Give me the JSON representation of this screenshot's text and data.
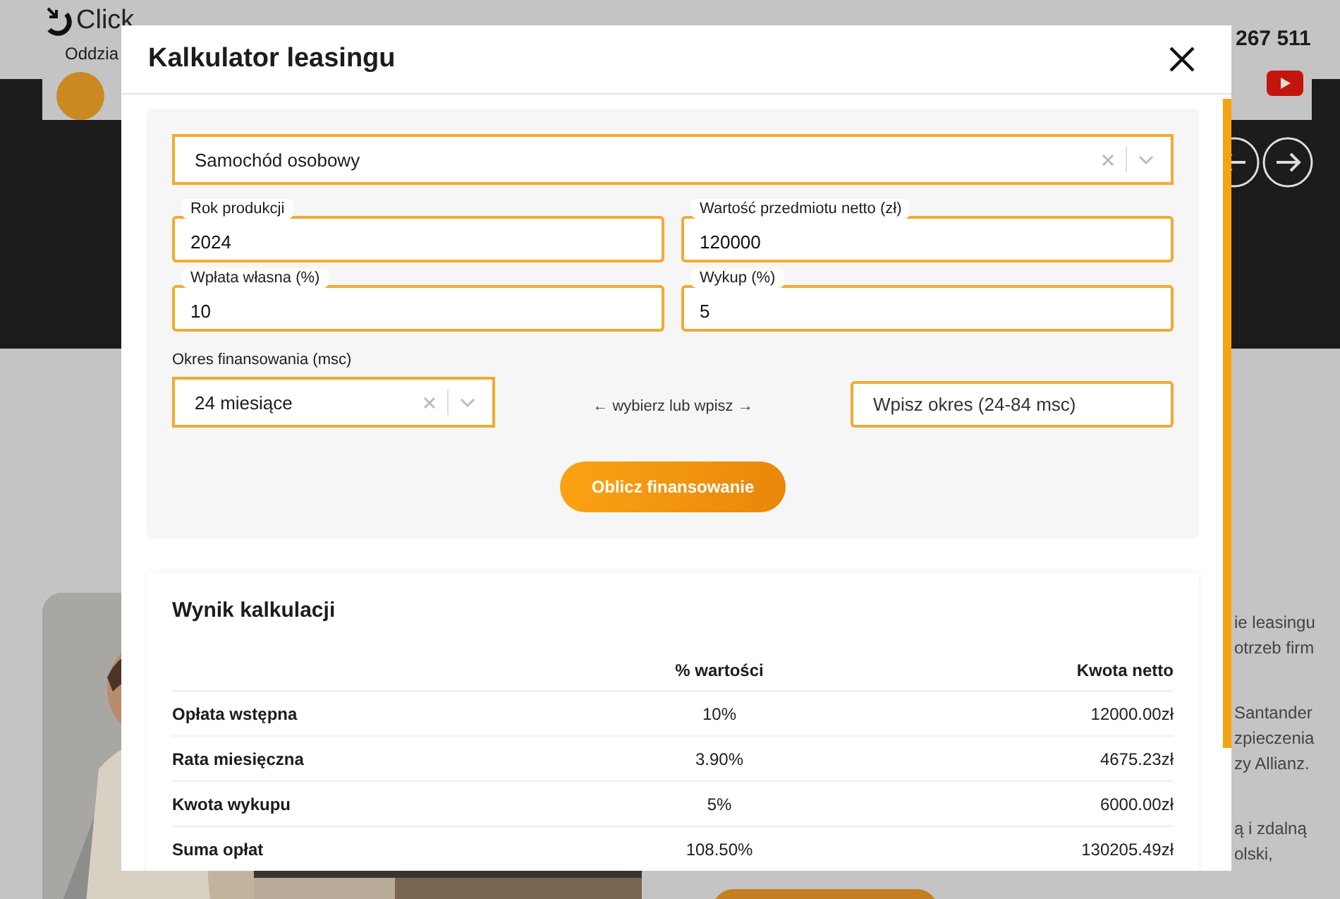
{
  "background_page": {
    "logo": "Click",
    "nav_item": "Oddzia",
    "phone": "267 511",
    "side_text": [
      "ie leasingu",
      "otrzeb firm",
      "Santander",
      "zpieczenia",
      "zy Allianz.",
      "ą i zdalną",
      "olski,"
    ]
  },
  "modal": {
    "title": "Kalkulator leasingu",
    "vehicle_select": {
      "value": "Samochód osobowy"
    },
    "fields": [
      {
        "label": "Rok produkcji",
        "value": "2024"
      },
      {
        "label": "Wartość przedmiotu netto (zł)",
        "value": "120000"
      },
      {
        "label": "Wpłata własna (%)",
        "value": "10"
      },
      {
        "label": "Wykup (%)",
        "value": "5"
      }
    ],
    "period": {
      "label": "Okres finansowania (msc)",
      "select_value": "24 miesiące",
      "hint": "← wybierz lub wpisz →",
      "input_placeholder": "Wpisz okres (24-84 msc)"
    },
    "submit": "Oblicz finansowanie",
    "result": {
      "title": "Wynik kalkulacji",
      "columns": [
        "% wartości",
        "Kwota netto"
      ],
      "rows": [
        {
          "label": "Opłata wstępna",
          "percent": "10%",
          "amount": "12000.00zł"
        },
        {
          "label": "Rata miesięczna",
          "percent": "3.90%",
          "amount": "4675.23zł"
        },
        {
          "label": "Kwota wykupu",
          "percent": "5%",
          "amount": "6000.00zł"
        },
        {
          "label": "Suma opłat",
          "percent": "108.50%",
          "amount": "130205.49zł"
        }
      ]
    }
  }
}
